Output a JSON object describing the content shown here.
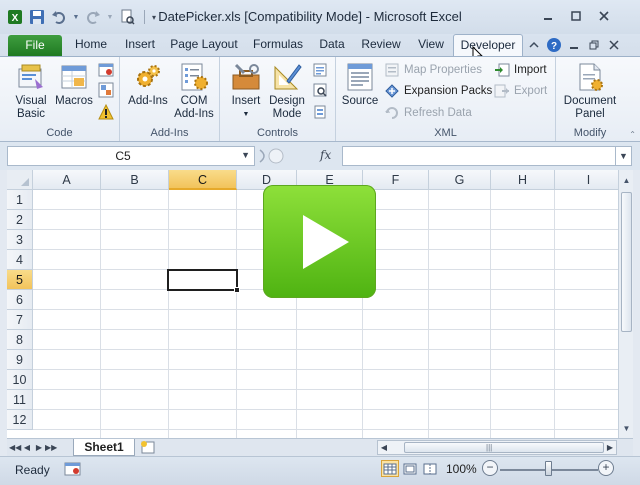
{
  "window": {
    "title": "DatePicker.xls  [Compatibility Mode]  -  Microsoft Excel"
  },
  "ribbon": {
    "tabs": [
      "File",
      "Home",
      "Insert",
      "Page Layout",
      "Formulas",
      "Data",
      "Review",
      "View",
      "Developer"
    ],
    "active_tab": "Developer",
    "groups": {
      "code": {
        "label": "Code",
        "visual_basic": [
          "Visual",
          "Basic"
        ],
        "macros": "Macros"
      },
      "addins": {
        "label": "Add-Ins",
        "addins": "Add-Ins",
        "com_addins": [
          "COM",
          "Add-Ins"
        ]
      },
      "controls": {
        "label": "Controls",
        "insert": "Insert",
        "design_mode": [
          "Design",
          "Mode"
        ]
      },
      "xml": {
        "label": "XML",
        "source": "Source",
        "map_properties": "Map Properties",
        "expansion_packs": "Expansion Packs",
        "refresh_data": "Refresh Data",
        "import": "Import",
        "export": "Export"
      },
      "modify": {
        "label": "Modify",
        "document_panel": [
          "Document",
          "Panel"
        ]
      }
    }
  },
  "formula_bar": {
    "name_box": "C5",
    "fx": "fx",
    "formula": ""
  },
  "grid": {
    "columns": [
      "A",
      "B",
      "C",
      "D",
      "E",
      "F",
      "G",
      "H",
      "I"
    ],
    "rows": [
      "1",
      "2",
      "3",
      "4",
      "5",
      "6",
      "7",
      "8",
      "9",
      "10",
      "11",
      "12"
    ],
    "selected_column": "C",
    "selected_row": "5"
  },
  "sheets": {
    "tabs": [
      "Sheet1"
    ]
  },
  "status": {
    "ready": "Ready",
    "zoom": "100%",
    "zoom_level_fraction": 0.5
  },
  "colors": {
    "file_tab": "#2a8a2c",
    "selection_header": "#f5c86a",
    "play_green": "#6cc927"
  }
}
